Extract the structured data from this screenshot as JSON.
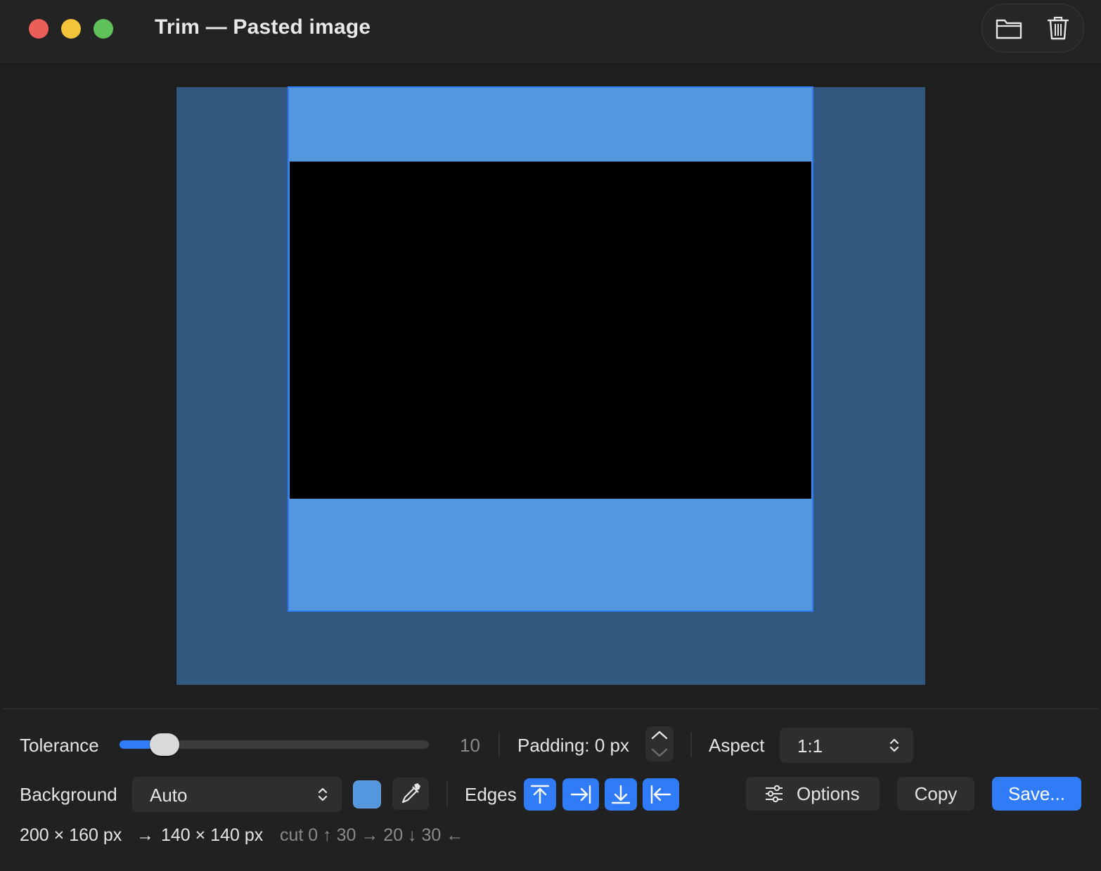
{
  "window": {
    "title": "Trim — Pasted image"
  },
  "toolbar": {
    "open_icon": "folder-icon",
    "delete_icon": "trash-icon"
  },
  "colors": {
    "image_background": "#33587f",
    "crop_fill": "#5597df",
    "crop_border": "#2f7cf6",
    "accent": "#2f7cf6",
    "content": "#000000"
  },
  "controls": {
    "tolerance_label": "Tolerance",
    "tolerance_value": "10",
    "tolerance_fraction": 0.1,
    "padding_label": "Padding: 0 px",
    "aspect_label": "Aspect",
    "aspect_value": "1:1",
    "background_label": "Background",
    "background_value": "Auto",
    "background_color": "#5597df",
    "edges_label": "Edges",
    "edges": [
      "top-edge-icon",
      "right-edge-icon",
      "bottom-edge-icon",
      "left-edge-icon"
    ],
    "options_label": "Options",
    "copy_label": "Copy",
    "save_label": "Save..."
  },
  "status": {
    "original_size": "200 × 160 px",
    "arrow": "→",
    "new_size": "140 × 140 px",
    "cut": "cut 0 ↑ 30 → 20 ↓ 30 ←"
  }
}
